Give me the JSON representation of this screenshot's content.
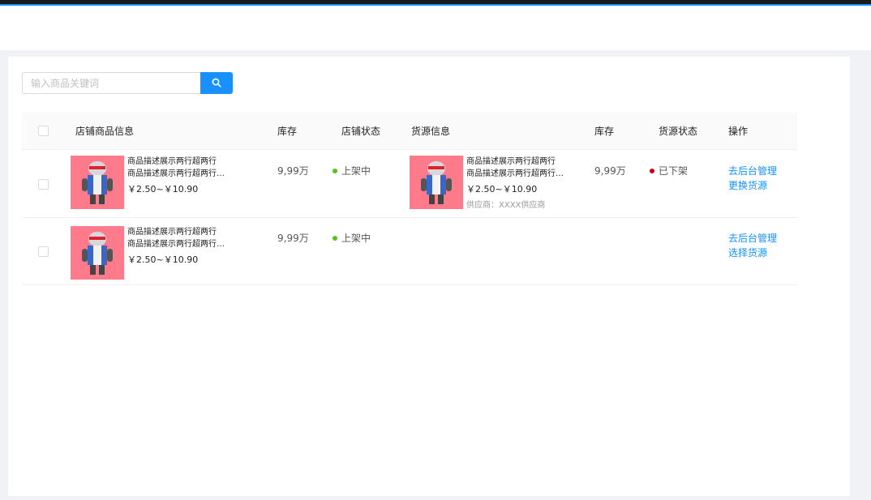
{
  "search": {
    "placeholder": "输入商品关键词",
    "button_icon": "search-icon"
  },
  "table": {
    "headers": {
      "shop_product": "店铺商品信息",
      "stock": "库存",
      "shop_status": "店铺状态",
      "source_info": "货源信息",
      "source_stock": "库存",
      "source_status": "货源状态",
      "actions": "操作"
    },
    "rows": [
      {
        "shop_product": {
          "desc_line1": "商品描述展示两行超两行",
          "desc_line2": "商品描述展示两行超两行…",
          "price": "￥2.50~￥10.90"
        },
        "stock": "9,99万",
        "shop_status": {
          "label": "上架中",
          "color": "#52c41a"
        },
        "source": {
          "desc_line1": "商品描述展示两行超两行",
          "desc_line2": "商品描述展示两行超两行…",
          "price": "￥2.50~￥10.90",
          "supplier": "供应商：XXXX供应商"
        },
        "source_stock": "9,99万",
        "source_status": {
          "label": "已下架",
          "color": "#d0021b"
        },
        "actions": {
          "primary": "去后台管理",
          "secondary": "更换货源"
        }
      },
      {
        "shop_product": {
          "desc_line1": "商品描述展示两行超两行",
          "desc_line2": "商品描述展示两行超两行…",
          "price": "￥2.50~￥10.90"
        },
        "stock": "9,99万",
        "shop_status": {
          "label": "上架中",
          "color": "#52c41a"
        },
        "actions": {
          "primary": "去后台管理",
          "secondary": "选择货源"
        }
      }
    ]
  },
  "colors": {
    "accent": "#1890ff",
    "status_on": "#52c41a",
    "status_off": "#d0021b",
    "thumb_bg": "#ff7a8a"
  }
}
